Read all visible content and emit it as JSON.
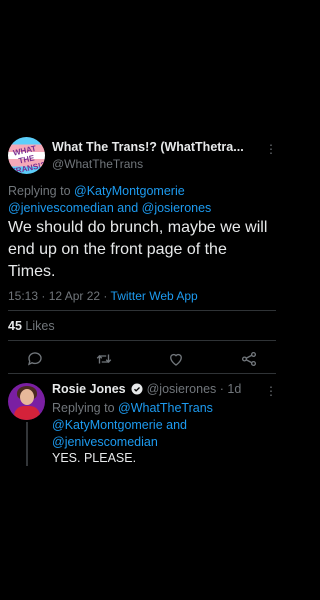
{
  "tweet": {
    "display_name": "What The Trans!? (WhatThetra...",
    "handle": "@WhatTheTrans",
    "avatar_text": "WHAT THE TRANS!?",
    "replying_prefix": "Replying to",
    "replying_to_1": "@KatyMontgomerie",
    "replying_to_2": "@jenivescomedian",
    "replying_and": "and",
    "replying_to_3": "@josierones",
    "text": "We should do brunch, maybe we will end up on the front page of the Times.",
    "timestamp": "15:13 · 12 Apr 22 ·",
    "source": "Twitter Web App",
    "likes_count": "45",
    "likes_label": "Likes",
    "more": "⋮"
  },
  "reply": {
    "display_name": "Rosie Jones",
    "handle_time": "@josierones · 1d",
    "replying_prefix": "Replying to",
    "replying_to_1": "@WhatTheTrans",
    "replying_to_2": "@KatyMontgomerie",
    "replying_and": "and",
    "replying_to_3": "@jenivescomedian",
    "text": "YES. PLEASE.",
    "more": "⋮"
  },
  "colors": {
    "background": "#000000",
    "text": "#e7e9ea",
    "muted": "#71767b",
    "accent": "#1d9bf0",
    "divider": "#2f3336"
  },
  "icons": [
    "reply-icon",
    "retweet-icon",
    "like-icon",
    "share-icon",
    "verified-badge-icon",
    "more-icon"
  ]
}
